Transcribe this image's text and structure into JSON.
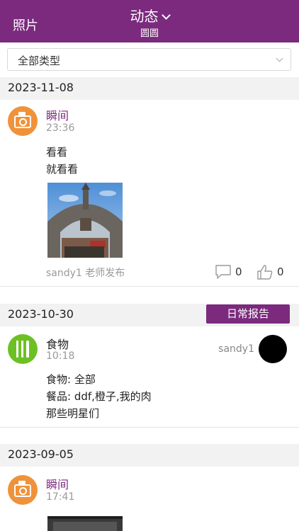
{
  "header": {
    "left_label": "照片",
    "title": "动态",
    "subtitle": "圆圆"
  },
  "filter": {
    "selected": "全部类型"
  },
  "feed": [
    {
      "date": "2023-11-08",
      "type_name": "瞬间",
      "time": "23:36",
      "lines": [
        "看看",
        "就看看"
      ],
      "author": "sandy1 老师发布",
      "comments": "0",
      "likes": "0"
    },
    {
      "date": "2023-10-30",
      "tag": "日常报告",
      "type_name": "食物",
      "time": "10:18",
      "teacher": "sandy1",
      "lines": [
        "食物: 全部",
        "餐品: ddf,橙子,我的肉",
        "那些明星们"
      ]
    },
    {
      "date": "2023-09-05",
      "type_name": "瞬间",
      "time": "17:41"
    }
  ],
  "colors": {
    "brand": "#7b2a7e",
    "moment_icon": "#f0923a",
    "food_icon": "#6cc024"
  },
  "icons": {
    "moment": "camera-icon",
    "food": "utensils-icon",
    "comment": "comment-icon",
    "like": "thumbs-up-icon"
  }
}
